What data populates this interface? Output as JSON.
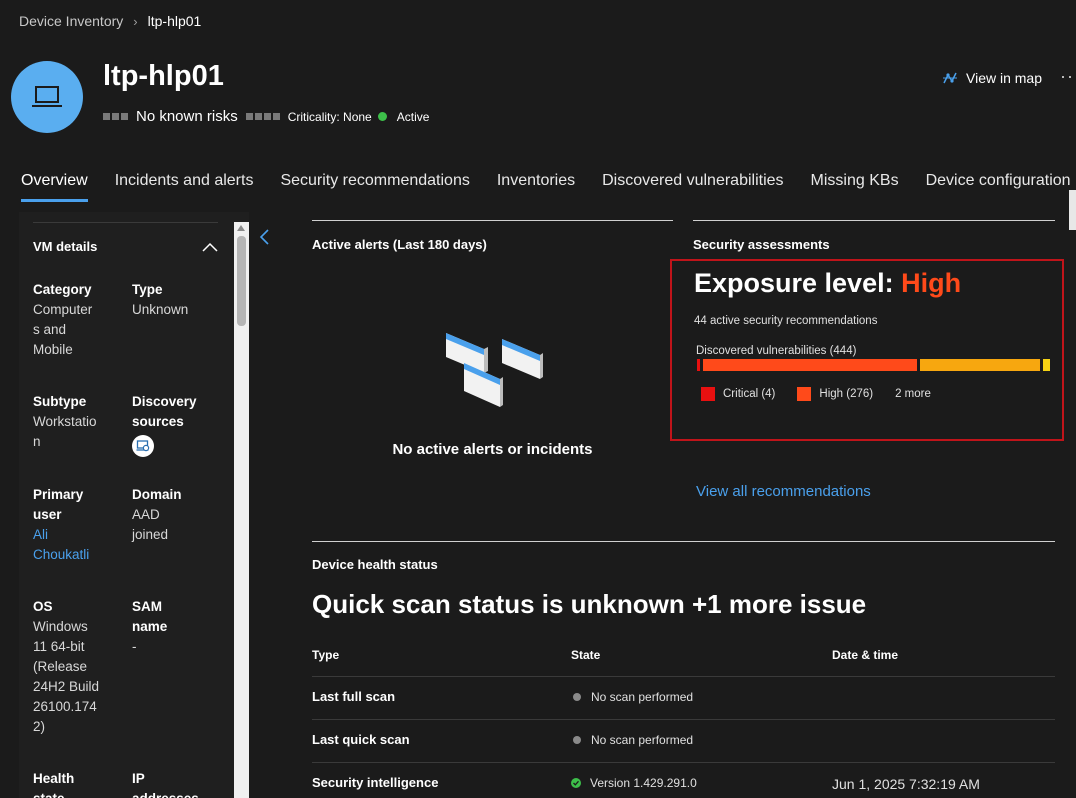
{
  "breadcrumb": {
    "parent": "Device Inventory",
    "separator": "›",
    "current": "ltp-hlp01"
  },
  "device": {
    "name": "ltp-hlp01",
    "risk": "No known risks",
    "criticality": "Criticality: None",
    "status": "Active"
  },
  "header_actions": {
    "view_map": "View in map",
    "more": "···"
  },
  "tabs": [
    {
      "label": "Overview"
    },
    {
      "label": "Incidents and alerts"
    },
    {
      "label": "Security recommendations"
    },
    {
      "label": "Inventories"
    },
    {
      "label": "Discovered vulnerabilities"
    },
    {
      "label": "Missing KBs"
    },
    {
      "label": "Device configuration"
    }
  ],
  "vm_details": {
    "title": "VM details",
    "category_label": "Category",
    "category_value": "Computer\ns and\nMobile",
    "type_label": "Type",
    "type_value": "Unknown",
    "subtype_label": "Subtype",
    "subtype_value": "Workstatio\nn",
    "discovery_label": "Discovery\nsources",
    "primary_user_label": "Primary\nuser",
    "primary_user_value": "Ali\nChoukatli",
    "domain_label": "Domain",
    "domain_value": "AAD\njoined",
    "os_label": "OS",
    "os_value": "Windows\n11 64-bit\n(Release\n24H2 Build\n26100.174\n2)",
    "sam_label": "SAM\nname",
    "sam_value": "-",
    "health_label": "Health\nstate",
    "ip_label": "IP\naddresses"
  },
  "alerts": {
    "title": "Active alerts (Last 180 days)",
    "empty": "No active alerts or incidents"
  },
  "security": {
    "title": "Security assessments",
    "exposure_prefix": "Exposure level: ",
    "exposure_level": "High",
    "recommendations": "44 active security recommendations",
    "vuln_label": "Discovered vulnerabilities (444)",
    "legend": [
      {
        "label": "Critical (4)",
        "color": "#e81010"
      },
      {
        "label": "High (276)",
        "color": "#ff4a1a"
      }
    ],
    "legend_more": "2 more",
    "view_all": "View all recommendations",
    "vuln_counts": {
      "critical": 4,
      "high": 276,
      "medium": 155,
      "low": 9,
      "total": 444
    },
    "colors": {
      "critical": "#e81010",
      "high": "#ff4a1a",
      "medium": "#f7a70f",
      "low": "#f5d214"
    }
  },
  "health": {
    "title": "Device health status",
    "headline": "Quick scan status is unknown +1 more issue",
    "columns": [
      "Type",
      "State",
      "Date & time"
    ],
    "rows": [
      {
        "type": "Last full scan",
        "state": "No scan performed",
        "date": ""
      },
      {
        "type": "Last quick scan",
        "state": "No scan performed",
        "date": ""
      },
      {
        "type": "Security intelligence",
        "state": "Version 1.429.291.0",
        "date": "Jun 1, 2025 7:32:19 AM"
      }
    ]
  }
}
